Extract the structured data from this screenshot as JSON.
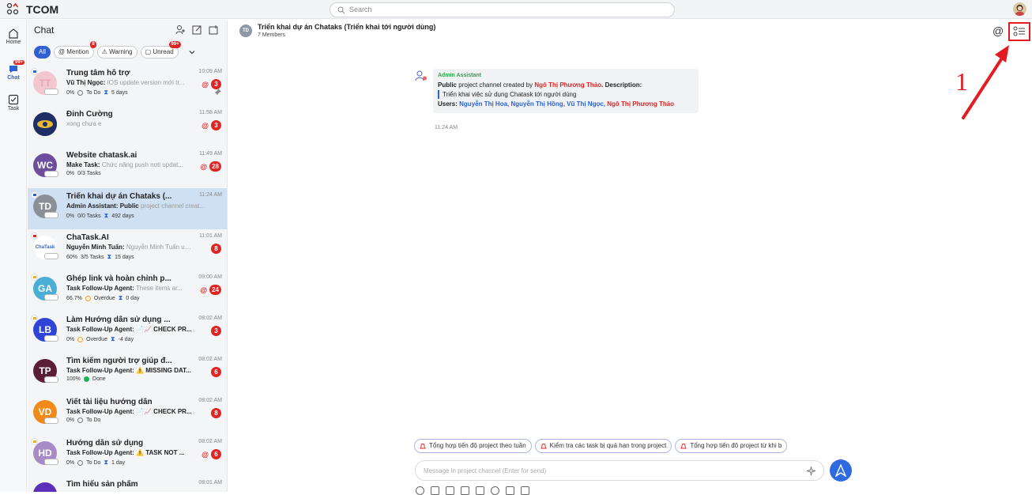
{
  "app": {
    "title": "TCOM"
  },
  "search": {
    "placeholder": "Search"
  },
  "rail": {
    "home": "Home",
    "chat": "Chat",
    "chat_badge": "99+",
    "task": "Task"
  },
  "chatlist": {
    "title": "Chat",
    "filters": {
      "all": "All",
      "mention": "Mention",
      "mention_badge": "8",
      "warning": "Warning",
      "unread": "Unread",
      "unread_badge": "99+"
    },
    "items": [
      {
        "name": "Trung tâm hỗ trợ",
        "time": "10:09 AM",
        "sender": "Vũ Thị Ngọc:",
        "preview": "IOS update version mới tr...",
        "meta_pct": "0%",
        "meta_status": "To Do",
        "meta_days": "5 days",
        "badge": "3",
        "initials": "TT",
        "color": "#f2c7cf"
      },
      {
        "name": "Đinh Cường",
        "time": "11:58 AM",
        "sender": "",
        "preview": "xong chưa e",
        "meta_pct": "",
        "meta_status": "",
        "meta_days": "",
        "badge": "3",
        "initials": "",
        "color": "#213b7a"
      },
      {
        "name": "Website chatask.ai",
        "time": "11:49 AM",
        "sender": "Make Task:",
        "preview": "Chức năng push noti updat...",
        "meta_pct": "0%",
        "meta_status": "0/3 Tasks",
        "meta_days": "",
        "badge": "28",
        "initials": "WC",
        "color": "#6c4e9c"
      },
      {
        "name": "Triển khai dự án Chataks (...",
        "time": "11:24 AM",
        "sender": "Admin Assistant:",
        "sender2": "Public",
        "preview": "project channel creat...",
        "meta_pct": "0%",
        "meta_status": "0/0 Tasks",
        "meta_days": "492 days",
        "badge": "",
        "initials": "TD",
        "color": "#8b9096"
      },
      {
        "name": "ChaTask.AI",
        "time": "11:01 AM",
        "sender": "Nguyễn Minh Tuấn:",
        "preview": "Nguyễn Minh Tuấn up...",
        "meta_pct": "60%",
        "meta_status": "3/5 Tasks",
        "meta_days": "15 days",
        "badge": "8",
        "initials": "ChaTask",
        "color": "#ffffff"
      },
      {
        "name": "Ghép link và hoàn chỉnh p...",
        "time": "09:00 AM",
        "sender": "Task Follow-Up Agent:",
        "preview": "These items ar...",
        "meta_pct": "66.7%",
        "meta_status": "Overdue",
        "meta_days": "0 day",
        "badge": "24",
        "initials": "GA",
        "color": "#4aaed6"
      },
      {
        "name": "Làm Hướng dẫn sử dụng ...",
        "time": "08:02 AM",
        "sender": "Task Follow-Up Agent:",
        "preview": "📄📈 CHECK PR...",
        "meta_pct": "0%",
        "meta_status": "Overdue",
        "meta_days": "-4 day",
        "badge": "3",
        "initials": "LB",
        "color": "#2f43d6"
      },
      {
        "name": "Tìm kiếm người trợ giúp đ...",
        "time": "08:02 AM",
        "sender": "Task Follow-Up Agent:",
        "preview": "⚠️ MISSING DAT...",
        "meta_pct": "100%",
        "meta_status": "Done",
        "meta_days": "",
        "badge": "6",
        "initials": "TP",
        "color": "#5a1f34"
      },
      {
        "name": "Viết tài liệu hướng dẫn",
        "time": "08:02 AM",
        "sender": "Task Follow-Up Agent:",
        "preview": "📄📈 CHECK PR...",
        "meta_pct": "0%",
        "meta_status": "To Do",
        "meta_days": "",
        "badge": "8",
        "initials": "VD",
        "color": "#f08a1a"
      },
      {
        "name": "Hướng dẫn sử dụng",
        "time": "08:02 AM",
        "sender": "Task Follow-Up Agent:",
        "preview": "⚠️ TASK NOT ...",
        "meta_pct": "0%",
        "meta_status": "To Do",
        "meta_days": "1 day",
        "badge": "6",
        "initials": "HD",
        "color": "#a78bc7"
      },
      {
        "name": "Tìm hiểu sản phẩm",
        "time": "08:01 AM",
        "sender": "",
        "preview": "",
        "meta_pct": "",
        "meta_status": "",
        "meta_days": "",
        "badge": "",
        "initials": "",
        "color": "#5b2fb8"
      }
    ]
  },
  "channel": {
    "initials": "TD",
    "title": "Triển khai dự án Chataks (Triển khai tới người dùng)",
    "members": "7 Members",
    "mention_icon": "@"
  },
  "annotation": {
    "number": "1"
  },
  "message": {
    "bot_name": "Admin Assistant",
    "line1_public": "Public",
    "line1_mid": "project channel created by",
    "line1_creator": "Ngô Thị Phương Thảo",
    "line1_desc": ". Description:",
    "quote": "Triển khai việc sử dụng Chatask tới người dùng",
    "users_label": "Users:",
    "users_blue": "Nguyễn Thị Hoa, Nguyễn Thị Hồng, Vũ Thị Ngọc,",
    "users_red": "Ngô Thị Phương Thảo",
    "time": "11:24 AM"
  },
  "suggestions": [
    "Tổng hợp tiến độ project theo tuần",
    "Kiểm tra các task bị quá hạn trong project",
    "Tổng hợp tiến độ project từ khi b"
  ],
  "composer": {
    "placeholder": "Message in project channel (Enter for send)"
  },
  "colors": {
    "accent": "#2f6be0",
    "alert": "#e02424",
    "selected": "#cfe0f2",
    "annotation": "#e31b23"
  }
}
